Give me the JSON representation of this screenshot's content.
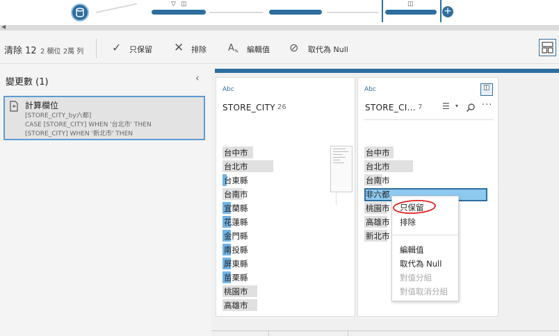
{
  "toolbar": {
    "clean_title": "清除 12",
    "stats": "2 欄位  2萬 列",
    "keep_only": "只保留",
    "exclude": "排除",
    "edit_value": "編輯值",
    "replace_null": "取代為 Null"
  },
  "left_panel": {
    "header": "變更數 (1)",
    "change": {
      "title": "計算欄位",
      "lines": [
        "[STORE_CITY_by六都]",
        "CASE [STORE_CITY] WHEN '台北市' THEN",
        "[STORE_CITY] WHEN '新北市' THEN"
      ]
    }
  },
  "field1": {
    "type_label": "Abc",
    "name": "STORE_CITY",
    "count": "26",
    "values": [
      {
        "label": "台中市",
        "share": 0.33,
        "highlight": 0
      },
      {
        "label": "台北市",
        "share": 0.55,
        "highlight": 0
      },
      {
        "label": "台東縣",
        "share": 0.03,
        "highlight": 0.5
      },
      {
        "label": "台南市",
        "share": 0.22,
        "highlight": 0
      },
      {
        "label": "宜蘭縣",
        "share": 0.05,
        "highlight": 1
      },
      {
        "label": "花蓮縣",
        "share": 0.05,
        "highlight": 1
      },
      {
        "label": "金門縣",
        "share": 0.01,
        "highlight": 1
      },
      {
        "label": "南投縣",
        "share": 0.04,
        "highlight": 1
      },
      {
        "label": "屏東縣",
        "share": 0.06,
        "highlight": 1
      },
      {
        "label": "苗栗縣",
        "share": 0.05,
        "highlight": 1
      },
      {
        "label": "桃園市",
        "share": 0.38,
        "highlight": 0
      },
      {
        "label": "高雄市",
        "share": 0.38,
        "highlight": 0
      }
    ]
  },
  "field2": {
    "type_label": "Abc",
    "name": "STORE_CI...",
    "count": "7",
    "values": [
      {
        "label": "台中市",
        "share": 0.38
      },
      {
        "label": "台北市",
        "share": 0.64
      },
      {
        "label": "台南市",
        "share": 0.24
      },
      {
        "label": "非六都",
        "share": 1.0
      },
      {
        "label": "桃園市",
        "share": 0.3
      },
      {
        "label": "高雄市",
        "share": 0.3
      },
      {
        "label": "新北市",
        "share": 0.3
      }
    ],
    "selected_value": "非六都"
  },
  "context_menu": {
    "items": [
      "只保留",
      "排除",
      "編輯值",
      "取代為 Null",
      "對值分組",
      "對值取消分組"
    ],
    "disabled": [
      "對值分組",
      "對值取消分組"
    ]
  },
  "colors": {
    "accent": "#2d6e9e",
    "selection": "#8ec9f0",
    "highlight": "#6fb3e8",
    "annotation": "#e02020"
  },
  "icons": {
    "flow_input": "database-icon",
    "keep_only": "checkmark-icon",
    "exclude": "x-icon",
    "edit_value": "edit-text-icon",
    "replace_null": "null-icon",
    "collapse": "chevron-left-icon",
    "layout_toggle": "layout-icon"
  }
}
